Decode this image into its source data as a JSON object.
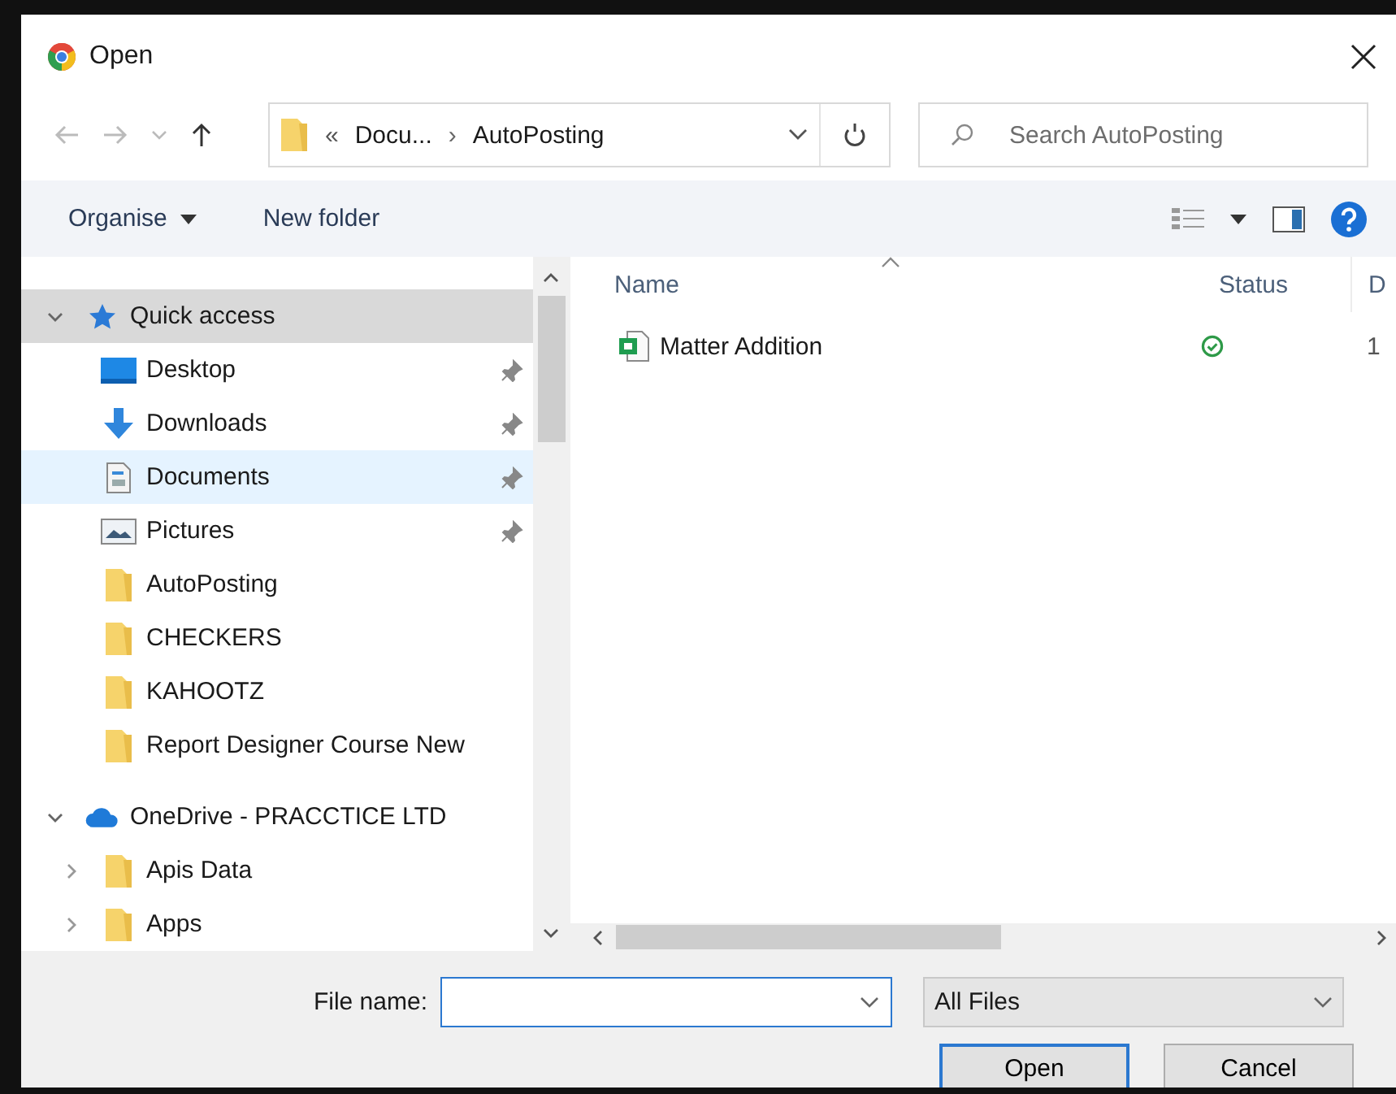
{
  "window": {
    "title": "Open"
  },
  "address": {
    "overflow": "«",
    "separator": "›",
    "path": [
      "Docu...",
      "AutoPosting"
    ]
  },
  "search": {
    "placeholder": "Search AutoPosting"
  },
  "toolbar": {
    "organise": "Organise",
    "new_folder": "New folder"
  },
  "nav_pane": {
    "items": [
      {
        "label": "Quick access",
        "kind": "star",
        "expanded": true,
        "selected": true,
        "hovered": false,
        "children": [
          {
            "label": "Desktop",
            "kind": "desktop",
            "pinned": true,
            "selected": false,
            "hovered": false
          },
          {
            "label": "Downloads",
            "kind": "download",
            "pinned": true,
            "selected": false,
            "hovered": false
          },
          {
            "label": "Documents",
            "kind": "document",
            "pinned": true,
            "selected": false,
            "hovered": true
          },
          {
            "label": "Pictures",
            "kind": "pictures",
            "pinned": true,
            "selected": false,
            "hovered": false
          },
          {
            "label": "AutoPosting",
            "kind": "folder",
            "pinned": false,
            "selected": false,
            "hovered": false
          },
          {
            "label": "CHECKERS",
            "kind": "folder",
            "pinned": false,
            "selected": false,
            "hovered": false
          },
          {
            "label": "KAHOOTZ",
            "kind": "folder",
            "pinned": false,
            "selected": false,
            "hovered": false
          },
          {
            "label": "Report Designer Course New",
            "kind": "folder",
            "pinned": false,
            "selected": false,
            "hovered": false
          }
        ]
      },
      {
        "label": "OneDrive - PRACCTICE LTD",
        "kind": "cloud",
        "expanded": true,
        "selected": false,
        "hovered": false,
        "children": [
          {
            "label": "Apis Data",
            "kind": "folder",
            "expanded": false,
            "selected": false,
            "hovered": false
          },
          {
            "label": "Apps",
            "kind": "folder",
            "expanded": false,
            "selected": false,
            "hovered": false
          }
        ]
      }
    ]
  },
  "file_list": {
    "columns": [
      {
        "label": "Name",
        "sorted": true
      },
      {
        "label": "Status",
        "sorted": false
      },
      {
        "label": "D",
        "sorted": false
      }
    ],
    "rows": [
      {
        "name": "Matter Addition",
        "column_3": "1"
      }
    ]
  },
  "footer": {
    "file_name_label": "File name:",
    "file_type": "All Files",
    "buttons": [
      {
        "label": "Open",
        "default": true
      },
      {
        "label": "Cancel",
        "default": false
      }
    ]
  }
}
